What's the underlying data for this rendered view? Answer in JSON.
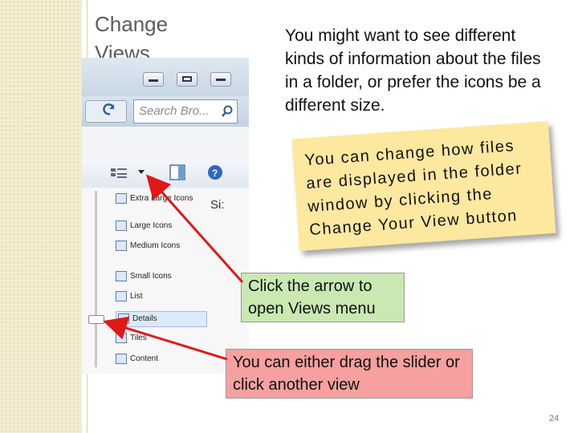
{
  "slide": {
    "title_line1": "Change",
    "title_line2": "Views",
    "body": "You might want to see different kinds of information about the files in a folder, or prefer the icons be a different size.",
    "note_lines": [
      "You can change how files",
      "are displayed in the folder",
      "window by clicking the",
      "Change Your View button"
    ],
    "callout_arrow": "Click the arrow to open Views menu",
    "callout_slider": "You can either drag the slider or click another view",
    "page_number": "24"
  },
  "screenshot": {
    "search_placeholder": "Search Bro...",
    "partial_label": "Si:",
    "view_items": [
      "Extra Large Icons",
      "Large Icons",
      "Medium Icons",
      "Small Icons",
      "List",
      "Details",
      "Tiles",
      "Content"
    ],
    "selected_item": "Details"
  },
  "colors": {
    "note_bg": "#fde8a0",
    "green_callout": "#c9e8b2",
    "red_callout": "#f6a0a0",
    "arrow": "#e01818"
  }
}
